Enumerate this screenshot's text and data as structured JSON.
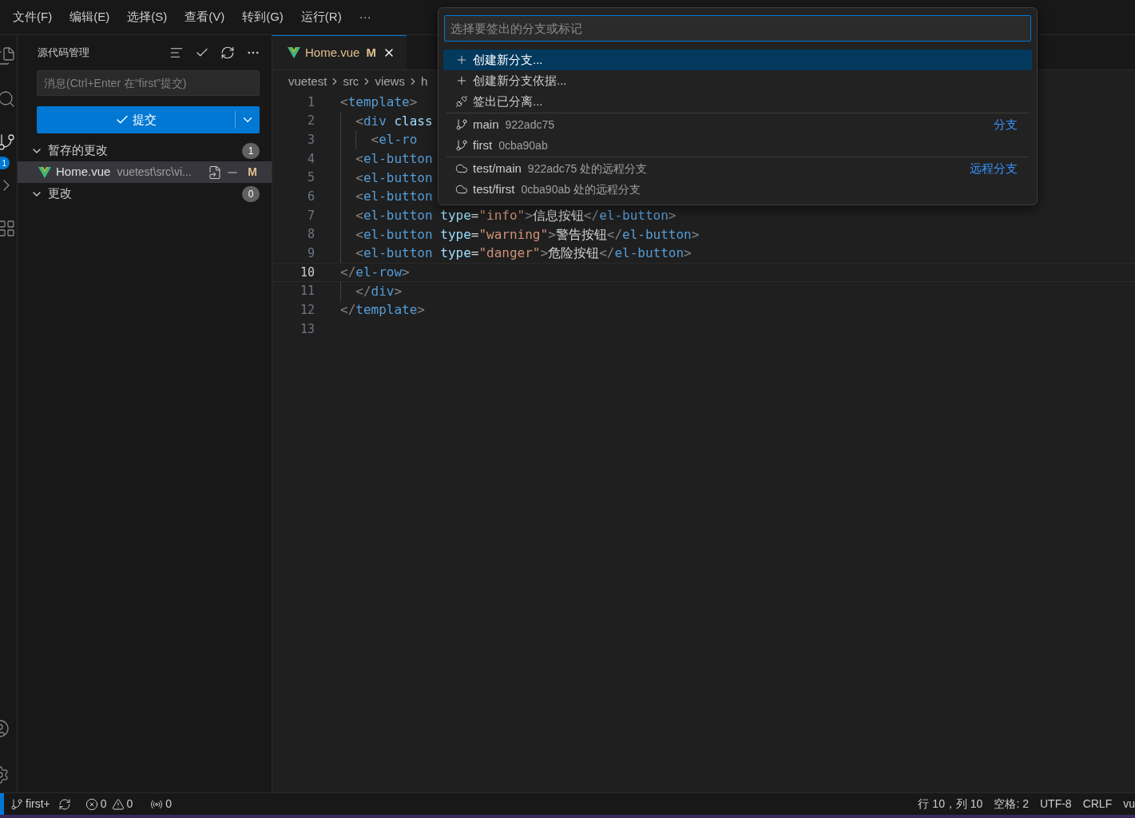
{
  "menu": {
    "items": [
      "文件(F)",
      "编辑(E)",
      "选择(S)",
      "查看(V)",
      "转到(G)",
      "运行(R)"
    ],
    "more": "···"
  },
  "activity_bar": {
    "badge": "1"
  },
  "sidebar": {
    "title": "源代码管理",
    "message_placeholder": "消息(Ctrl+Enter 在“first”提交)",
    "commit_label": "提交",
    "groups": [
      {
        "label": "暂存的更改",
        "count": "1",
        "expanded": true,
        "files": [
          {
            "name": "Home.vue",
            "path": "vuetest\\src\\vi...",
            "status": "M",
            "selected": true
          }
        ]
      },
      {
        "label": "更改",
        "count": "0",
        "expanded": true
      }
    ]
  },
  "editor": {
    "tab": {
      "name": "Home.vue",
      "status": "M",
      "selected": true
    },
    "breadcrumbs": [
      "vuetest",
      "src",
      "views",
      "h"
    ],
    "lines": [
      {
        "number": "1",
        "current": false,
        "tokens": [
          {
            "kind": "punct",
            "text": "<"
          },
          {
            "kind": "tag",
            "text": "template"
          },
          {
            "kind": "punct",
            "text": ">"
          }
        ]
      },
      {
        "number": "2",
        "current": false,
        "tokens": [
          {
            "kind": "punct",
            "text": "  <"
          },
          {
            "kind": "tag",
            "text": "div"
          },
          {
            "kind": "attr",
            "text": " class"
          }
        ]
      },
      {
        "number": "3",
        "current": false,
        "tokens": [
          {
            "kind": "punct",
            "text": "    <"
          },
          {
            "kind": "tag",
            "text": "el-ro"
          }
        ]
      },
      {
        "number": "4",
        "current": false,
        "tokens": [
          {
            "kind": "punct",
            "text": "  <"
          },
          {
            "kind": "tag",
            "text": "el-button"
          }
        ]
      },
      {
        "number": "5",
        "current": false,
        "tokens": [
          {
            "kind": "punct",
            "text": "  <"
          },
          {
            "kind": "tag",
            "text": "el-button"
          }
        ]
      },
      {
        "number": "6",
        "current": false,
        "tokens": [
          {
            "kind": "punct",
            "text": "  <"
          },
          {
            "kind": "tag",
            "text": "el-button"
          }
        ]
      },
      {
        "number": "7",
        "current": false,
        "tokens": [
          {
            "kind": "punct",
            "text": "  <"
          },
          {
            "kind": "tag",
            "text": "el-button"
          },
          {
            "kind": "attr",
            "text": " type"
          },
          {
            "kind": "text",
            "text": "="
          },
          {
            "kind": "string",
            "text": "\"info\""
          },
          {
            "kind": "punct",
            "text": ">"
          },
          {
            "kind": "text",
            "text": "信息按钮"
          },
          {
            "kind": "punct",
            "text": "</"
          },
          {
            "kind": "tag",
            "text": "el-button"
          },
          {
            "kind": "punct",
            "text": ">"
          }
        ]
      },
      {
        "number": "8",
        "current": false,
        "tokens": [
          {
            "kind": "punct",
            "text": "  <"
          },
          {
            "kind": "tag",
            "text": "el-button"
          },
          {
            "kind": "attr",
            "text": " type"
          },
          {
            "kind": "text",
            "text": "="
          },
          {
            "kind": "string",
            "text": "\"warning\""
          },
          {
            "kind": "punct",
            "text": ">"
          },
          {
            "kind": "text",
            "text": "警告按钮"
          },
          {
            "kind": "punct",
            "text": "</"
          },
          {
            "kind": "tag",
            "text": "el-button"
          },
          {
            "kind": "punct",
            "text": ">"
          }
        ]
      },
      {
        "number": "9",
        "current": false,
        "tokens": [
          {
            "kind": "punct",
            "text": "  <"
          },
          {
            "kind": "tag",
            "text": "el-button"
          },
          {
            "kind": "attr",
            "text": " type"
          },
          {
            "kind": "text",
            "text": "="
          },
          {
            "kind": "string",
            "text": "\"danger\""
          },
          {
            "kind": "punct",
            "text": ">"
          },
          {
            "kind": "text",
            "text": "危险按钮"
          },
          {
            "kind": "punct",
            "text": "</"
          },
          {
            "kind": "tag",
            "text": "el-button"
          },
          {
            "kind": "punct",
            "text": ">"
          }
        ]
      },
      {
        "number": "10",
        "current": true,
        "tokens": [
          {
            "kind": "punct",
            "text": "</"
          },
          {
            "kind": "tag",
            "text": "el-row"
          },
          {
            "kind": "punct",
            "text": ">"
          }
        ]
      },
      {
        "number": "11",
        "current": false,
        "tokens": [
          {
            "kind": "punct",
            "text": "  </"
          },
          {
            "kind": "tag",
            "text": "div"
          },
          {
            "kind": "punct",
            "text": ">"
          }
        ]
      },
      {
        "number": "12",
        "current": false,
        "tokens": [
          {
            "kind": "punct",
            "text": "</"
          },
          {
            "kind": "tag",
            "text": "template"
          },
          {
            "kind": "punct",
            "text": ">"
          }
        ]
      },
      {
        "number": "13",
        "current": false
      }
    ]
  },
  "quick_pick": {
    "placeholder": "选择要签出的分支或标记",
    "items": [
      {
        "kind": "create",
        "label": "创建新分支...",
        "selected": true
      },
      {
        "kind": "create",
        "label": "创建新分支依据...",
        "selected": false
      },
      {
        "kind": "detach",
        "label": "签出已分离...",
        "selected": false
      },
      {
        "kind": "branch",
        "label": "main",
        "detail": "922adc75",
        "group_label": "分支",
        "selected": false
      },
      {
        "kind": "branch",
        "label": "first",
        "detail": "0cba90ab",
        "selected": false
      },
      {
        "kind": "remote",
        "label": "test/main",
        "detail": "922adc75 处的远程分支",
        "group_label": "远程分支",
        "selected": false
      },
      {
        "kind": "remote",
        "label": "test/first",
        "detail": "0cba90ab 处的远程分支",
        "selected": false
      }
    ]
  },
  "status_bar": {
    "branch": "first+",
    "errors": "0",
    "warnings": "0",
    "ports": "0",
    "right": [
      "行 10，列 10",
      "空格: 2",
      "UTF-8",
      "CRLF",
      "vu"
    ]
  }
}
